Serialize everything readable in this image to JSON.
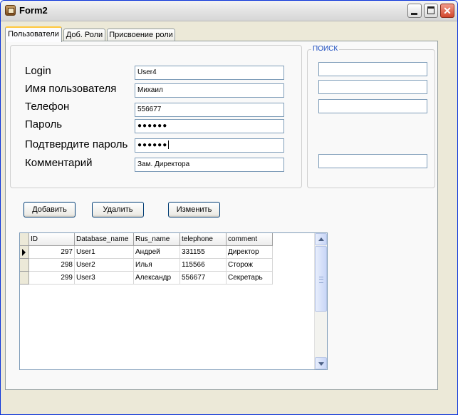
{
  "window": {
    "title": "Form2"
  },
  "tabs": [
    {
      "label": "Пользователи",
      "active": true
    },
    {
      "label": "Доб. Роли",
      "active": false
    },
    {
      "label": "Присвоение роли",
      "active": false
    }
  ],
  "search": {
    "legend": "ПОИСК",
    "fields": [
      "",
      "",
      "",
      ""
    ]
  },
  "form": {
    "login": {
      "label": "Login",
      "value": "User4"
    },
    "username": {
      "label": "Имя пользователя",
      "value": "Михаил"
    },
    "phone": {
      "label": "Телефон",
      "value": "556677"
    },
    "password": {
      "label": "Пароль",
      "value": "●●●●●●"
    },
    "confirm": {
      "label": "Подтвердите пароль",
      "value": "●●●●●●"
    },
    "comment": {
      "label": "Комментарий",
      "value": "Зам. Директора"
    }
  },
  "buttons": {
    "add": "Добавить",
    "delete": "Удалить",
    "edit": "Изменить"
  },
  "grid": {
    "columns": [
      "ID",
      "Database_name",
      "Rus_name",
      "telephone",
      "comment"
    ],
    "rows": [
      {
        "id": "297",
        "db": "User1",
        "rus": "Андрей",
        "tel": "331155",
        "comment": "Директор",
        "current": true
      },
      {
        "id": "298",
        "db": "User2",
        "rus": "Илья",
        "tel": "115566",
        "comment": "Сторож",
        "current": false
      },
      {
        "id": "299",
        "db": "User3",
        "rus": "Александр",
        "tel": "556677",
        "comment": "Секретарь",
        "current": false
      }
    ]
  },
  "colors": {
    "titlebar_close": "#d2462c",
    "tab_highlight": "#ffc83c",
    "legend": "#1a4bbf"
  }
}
